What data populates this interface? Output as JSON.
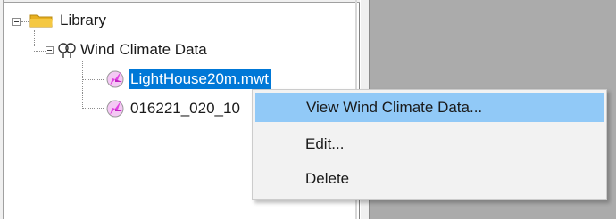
{
  "tree": {
    "library": {
      "label": "Library"
    },
    "wind_climate": {
      "label": "Wind Climate Data"
    },
    "items": [
      {
        "label": "LightHouse20m.mwt",
        "selected": true
      },
      {
        "label": "016221_020_10"
      }
    ]
  },
  "context_menu": {
    "items": [
      {
        "label": "View Wind Climate Data...",
        "highlighted": true
      },
      {
        "label": "Edit..."
      },
      {
        "label": "Delete"
      }
    ]
  },
  "colors": {
    "selection": "#0078d7",
    "menu_highlight": "#91c9f7",
    "folder": "#f5c842",
    "wind_icon": "#e040e0"
  }
}
